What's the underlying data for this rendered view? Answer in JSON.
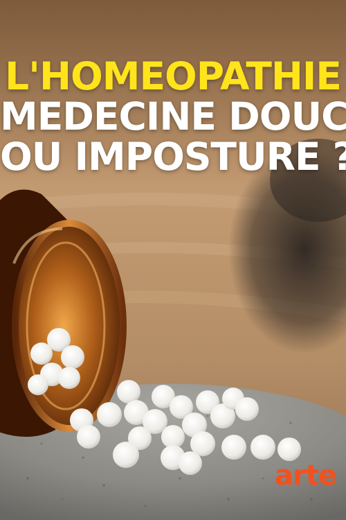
{
  "title": {
    "line1": "L'HOMEOPATHIE",
    "line2": "MEDECINE DOUCE",
    "line3": "OU IMPOSTURE ?"
  },
  "logo": "arte",
  "colors": {
    "title_highlight": "#ffe41c",
    "title_text": "#ffffff",
    "logo": "#f4501e"
  }
}
